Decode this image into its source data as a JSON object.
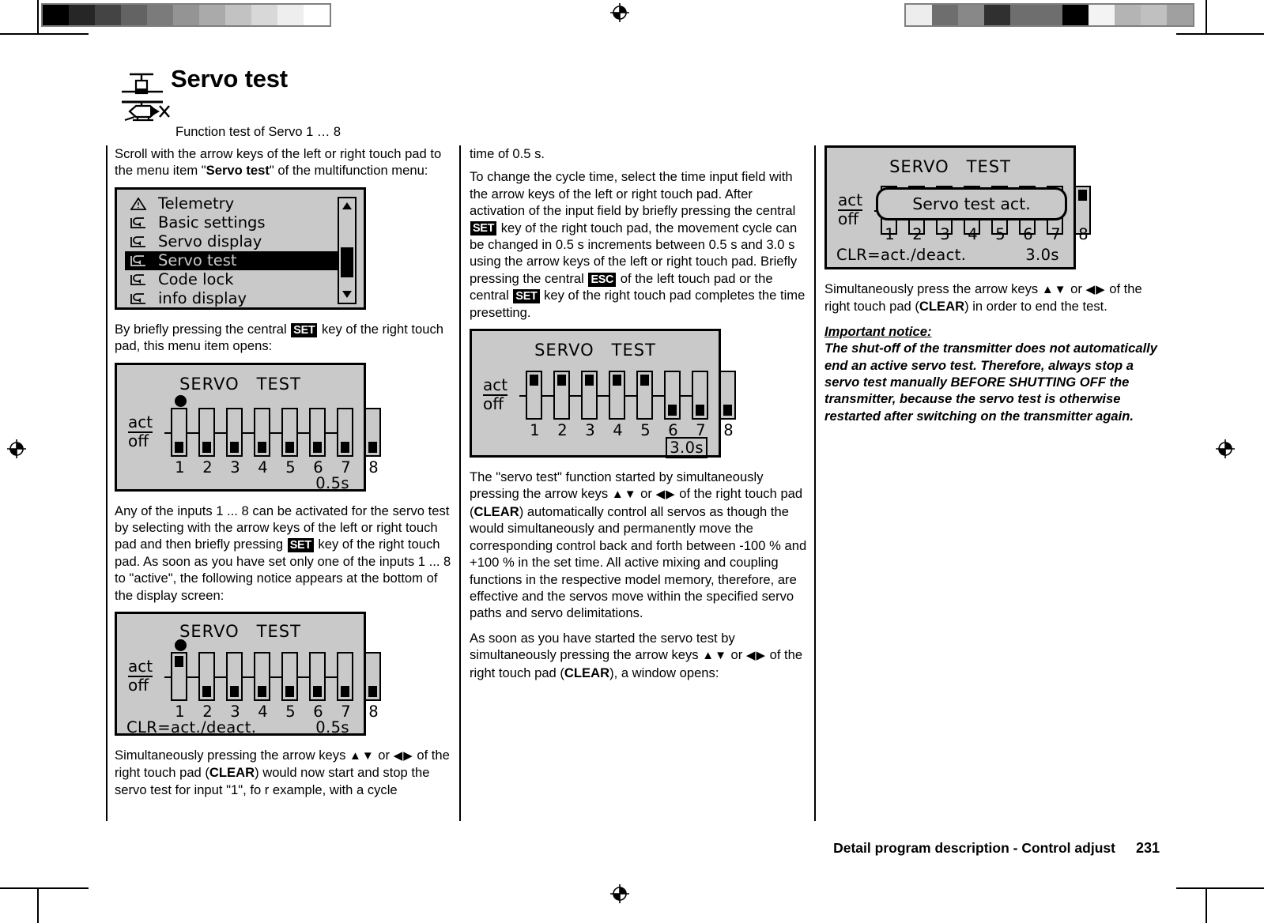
{
  "header": {
    "title": "Servo test",
    "subtitle": "Function test of Servo 1 … 8",
    "icon_top": "helicopter-rotor-icon",
    "icon_bottom": "helicopter-side-icon"
  },
  "footer": {
    "text": "Detail program description - Control adjust",
    "page_number": "231"
  },
  "calibration": {
    "left_swatches": [
      "#000000",
      "#262626",
      "#444444",
      "#636363",
      "#7b7b7b",
      "#949494",
      "#aaaaaa",
      "#c2c2c2",
      "#d8d8d8",
      "#eeeeee",
      "#ffffff"
    ],
    "right_swatches": [
      "#ededed",
      "#6e6e6e",
      "#888888",
      "#303030",
      "#6e6e6e",
      "#6e6e6e",
      "#000000",
      "#f3f3f3",
      "#b4b4b4",
      "#c0c0c0",
      "#a0a0a0"
    ]
  },
  "menu_screen": {
    "name": "multifunction-menu",
    "items": [
      {
        "icon": "warning-triangle-icon",
        "label": "Telemetry",
        "selected": false
      },
      {
        "icon": "return-arrow-icon",
        "label": "Basic settings",
        "selected": false
      },
      {
        "icon": "return-arrow-icon",
        "label": "Servo display",
        "selected": false
      },
      {
        "icon": "return-arrow-icon",
        "label": "Servo test",
        "selected": true
      },
      {
        "icon": "return-arrow-icon",
        "label": "Code lock",
        "selected": false
      },
      {
        "icon": "return-arrow-icon",
        "label": "info display",
        "selected": false
      }
    ],
    "scrollbar": {
      "up": "▲",
      "down": "▼",
      "thumb_top_pct": 46,
      "thumb_height_pct": 30
    }
  },
  "servo_screens": [
    {
      "id": "servo-test-display-1",
      "title_left": "SERVO",
      "title_right": "TEST",
      "label_act": "act",
      "label_off": "off",
      "channels": [
        "1",
        "2",
        "3",
        "4",
        "5",
        "6",
        "7",
        "8"
      ],
      "states": [
        "off",
        "off",
        "off",
        "off",
        "off",
        "off",
        "off",
        "off"
      ],
      "cursor_channel": 1,
      "cycle_time": "0.5s",
      "time_boxed": false,
      "clr_hint": "",
      "popup": ""
    },
    {
      "id": "servo-test-display-2",
      "title_left": "SERVO",
      "title_right": "TEST",
      "label_act": "act",
      "label_off": "off",
      "channels": [
        "1",
        "2",
        "3",
        "4",
        "5",
        "6",
        "7",
        "8"
      ],
      "states": [
        "act",
        "off",
        "off",
        "off",
        "off",
        "off",
        "off",
        "off"
      ],
      "cursor_channel": 1,
      "cycle_time": "0.5s",
      "time_boxed": false,
      "clr_hint": "CLR=act./deact.",
      "popup": ""
    },
    {
      "id": "servo-test-display-3",
      "title_left": "SERVO",
      "title_right": "TEST",
      "label_act": "act",
      "label_off": "off",
      "channels": [
        "1",
        "2",
        "3",
        "4",
        "5",
        "6",
        "7",
        "8"
      ],
      "states": [
        "act",
        "act",
        "act",
        "act",
        "act",
        "off",
        "off",
        "off"
      ],
      "cursor_channel": 0,
      "cycle_time": "3.0s",
      "time_boxed": true,
      "clr_hint": "",
      "popup": ""
    },
    {
      "id": "servo-test-display-4",
      "title_left": "SERVO",
      "title_right": "TEST",
      "label_act": "act",
      "label_off": "off",
      "channels": [
        "1",
        "2",
        "3",
        "4",
        "5",
        "6",
        "7",
        "8"
      ],
      "states": [
        "act",
        "act",
        "act",
        "act",
        "act",
        "act",
        "act",
        "act"
      ],
      "cursor_channel": 0,
      "cycle_time": "3.0s",
      "time_boxed": false,
      "clr_hint": "CLR=act./deact.",
      "popup": "Servo test act."
    }
  ],
  "keys": {
    "set": "SET",
    "esc": "ESC",
    "clear": "CLEAR",
    "arrows_vertical": "▲▼",
    "arrows_horizontal": "◀▶"
  },
  "column1": {
    "p1_a": "Scroll with the arrow keys of the left or right touch pad to the menu item \"",
    "p1_b": "Servo test",
    "p1_c": "\" of the multifunction menu:",
    "p2_a": "By briefly pressing the central ",
    "p2_b": " key of the right touch pad, this menu item opens:",
    "p3_a": "Any of the inputs 1 ... 8 can be activated for the servo test by selecting with the arrow keys of the left or right touch pad and then briefly pressing ",
    "p3_b": " key of the right touch pad. As soon as you have set only one of the inputs 1 ... 8 to \"active\", the following notice appears at the bottom of the display screen:",
    "p4_a": "Simultaneously pressing the arrow keys ",
    "p4_or": " or ",
    "p4_b": " of the right touch pad (",
    "p4_c": ") would now start and stop the servo test for input \"1\", fo r example, with a cycle"
  },
  "column2": {
    "p1": "time of 0.5 s.",
    "p2_a": "To change the cycle time, select the time input field with the arrow keys of the left or right touch pad. After activation of the input field by briefly pressing the central ",
    "p2_b": " key of the right touch pad, the movement cycle can be changed in 0.5 s increments between 0.5 s and 3.0 s using the arrow keys of the left or right touch pad. Briefly pressing the central ",
    "p2_c": " of the left touch pad or the central ",
    "p2_d": " key of the right touch pad completes the time presetting.",
    "p3_a": "The \"servo test\" function started by simultaneously pressing the arrow keys ",
    "p3_or": " or ",
    "p3_b": " of the right touch pad (",
    "p3_c": ") automatically control all servos as though the would simultaneously and permanently move the corresponding control back and forth between -100 % and +100 % in the set time. All active mixing and coupling functions in the respective model memory, therefore, are effective and the servos move within the specified servo paths and servo delimitations.",
    "p4_a": "As soon as you have started the servo test by simultaneously pressing the arrow keys ",
    "p4_or": " or ",
    "p4_b": " of the right touch pad (",
    "p4_c": "), a window opens:"
  },
  "column3": {
    "p1_a": "Simultaneously press the arrow keys ",
    "p1_or": " or ",
    "p1_b": " of the right touch pad (",
    "p1_c": ") in order to end the test.",
    "notice_head": "Important notice:",
    "notice_body": "The shut-off of the transmitter does not automatically end an active servo test. Therefore, always stop a servo test manually BEFORE SHUTTING OFF the transmitter, because the servo test is otherwise restarted after switching on the transmitter again."
  }
}
